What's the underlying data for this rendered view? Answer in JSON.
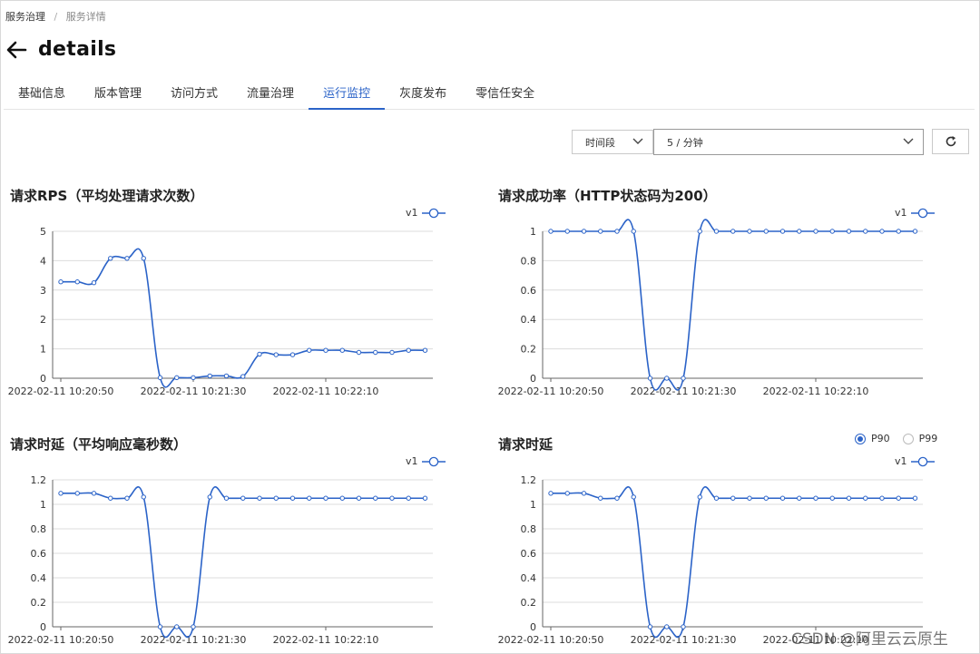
{
  "breadcrumb": {
    "root": "服务治理",
    "separator": "/",
    "current": "服务详情"
  },
  "page": {
    "title": "details"
  },
  "tabs": [
    {
      "label": "基础信息",
      "active": false
    },
    {
      "label": "版本管理",
      "active": false
    },
    {
      "label": "访问方式",
      "active": false
    },
    {
      "label": "流量治理",
      "active": false
    },
    {
      "label": "运行监控",
      "active": true
    },
    {
      "label": "灰度发布",
      "active": false
    },
    {
      "label": "零信任安全",
      "active": false
    }
  ],
  "toolbar": {
    "range_label": "时间段",
    "interval_value": "5 / 分钟"
  },
  "accent_color": "#2b63c8",
  "latency_percentile": {
    "options": [
      "P90",
      "P99"
    ],
    "selected": "P90"
  },
  "watermark": "CSDN @阿里云云原生",
  "chart_data": [
    {
      "type": "line",
      "title": "请求RPS（平均处理请求次数）",
      "series": [
        {
          "name": "v1",
          "values": [
            3.28,
            3.28,
            3.25,
            4.08,
            4.08,
            4.08,
            0.02,
            0.02,
            0.02,
            0.08,
            0.08,
            0.06,
            0.82,
            0.8,
            0.8,
            0.95,
            0.95,
            0.95,
            0.88,
            0.88,
            0.88,
            0.95,
            0.95
          ]
        }
      ],
      "y_ticks": [
        "0",
        "1",
        "2",
        "3",
        "4",
        "5"
      ],
      "ylim": [
        0,
        5
      ],
      "x_labels": [
        "2022-02-11 10:20:50",
        "2022-02-11 10:21:30",
        "2022-02-11 10:22:10"
      ],
      "legend": "top-right",
      "grid": true
    },
    {
      "type": "line",
      "title": "请求成功率（HTTP状态码为200）",
      "series": [
        {
          "name": "v1",
          "values": [
            1,
            1,
            1,
            1,
            1,
            1,
            0,
            0,
            0,
            1,
            1,
            1,
            1,
            1,
            1,
            1,
            1,
            1,
            1,
            1,
            1,
            1,
            1
          ]
        }
      ],
      "y_ticks": [
        "0",
        "0.2",
        "0.4",
        "0.6",
        "0.8",
        "1"
      ],
      "ylim": [
        0,
        1
      ],
      "x_labels": [
        "2022-02-11 10:20:50",
        "2022-02-11 10:21:30",
        "2022-02-11 10:22:10"
      ],
      "legend": "top-right",
      "grid": true
    },
    {
      "type": "line",
      "title": "请求时延（平均响应毫秒数）",
      "series": [
        {
          "name": "v1",
          "values": [
            1.09,
            1.09,
            1.09,
            1.05,
            1.05,
            1.06,
            0,
            0,
            0,
            1.06,
            1.05,
            1.05,
            1.05,
            1.05,
            1.05,
            1.05,
            1.05,
            1.05,
            1.05,
            1.05,
            1.05,
            1.05,
            1.05
          ]
        }
      ],
      "y_ticks": [
        "0",
        "0.2",
        "0.4",
        "0.6",
        "0.8",
        "1",
        "1.2"
      ],
      "ylim": [
        0,
        1.2
      ],
      "x_labels": [
        "2022-02-11 10:20:50",
        "2022-02-11 10:21:30",
        "2022-02-11 10:22:10"
      ],
      "legend": "top-right",
      "grid": true
    },
    {
      "type": "line",
      "title": "请求时延",
      "series": [
        {
          "name": "v1",
          "values": [
            1.09,
            1.09,
            1.09,
            1.05,
            1.05,
            1.06,
            0,
            0,
            0,
            1.06,
            1.05,
            1.05,
            1.05,
            1.05,
            1.05,
            1.05,
            1.05,
            1.05,
            1.05,
            1.05,
            1.05,
            1.05,
            1.05
          ]
        }
      ],
      "y_ticks": [
        "0",
        "0.2",
        "0.4",
        "0.6",
        "0.8",
        "1",
        "1.2"
      ],
      "ylim": [
        0,
        1.2
      ],
      "x_labels": [
        "2022-02-11 10:20:50",
        "2022-02-11 10:21:30",
        "2022-02-11 10:22:10"
      ],
      "legend": "top-right",
      "grid": true
    }
  ]
}
